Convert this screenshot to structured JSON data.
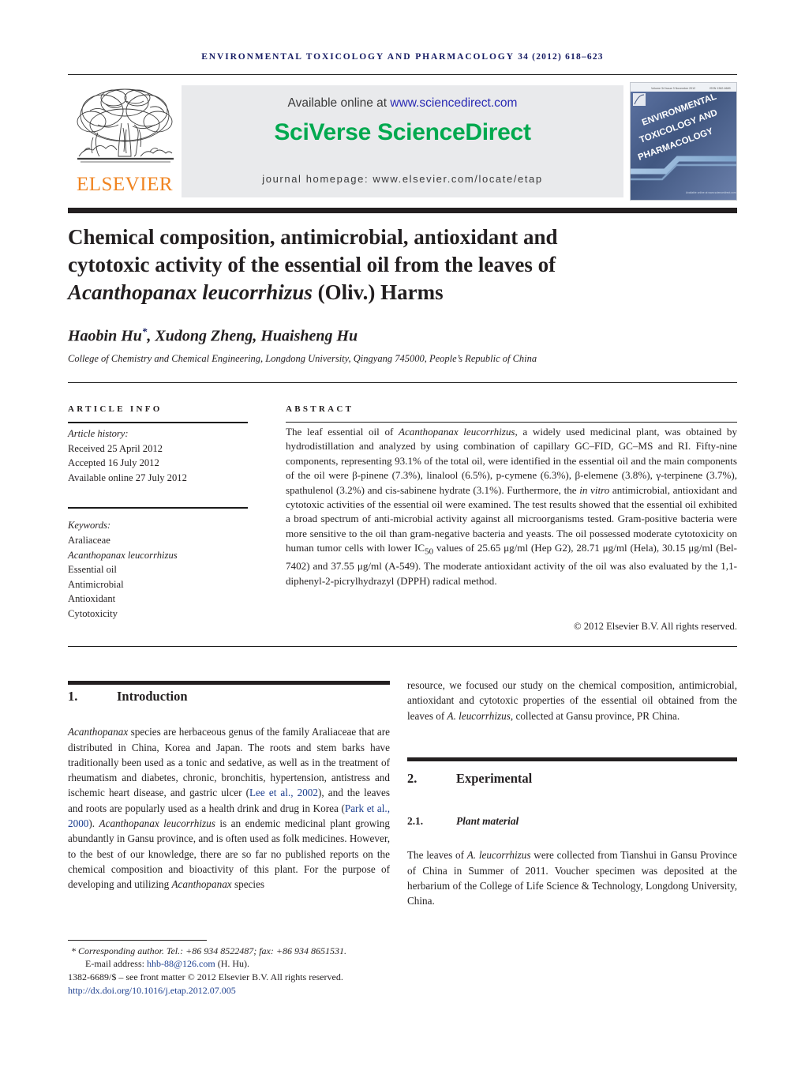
{
  "running_head": {
    "journal": "ENVIRONMENTAL TOXICOLOGY AND PHARMACOLOGY",
    "volume_issue": "34 (2012) 618–623"
  },
  "masthead": {
    "publisher_name": "ELSEVIER",
    "available_text": "Available online at ",
    "sciencedirect_url": "www.sciencedirect.com",
    "platform_logo": "SciVerse ScienceDirect",
    "journal_homepage": "journal homepage: www.elsevier.com/locate/etap",
    "cover_title_line1": "ENVIRONMENTAL",
    "cover_title_line2": "TOXICOLOGY AND",
    "cover_title_line3": "PHARMACOLOGY",
    "cover_top_meta": "Volume 34  Issue 3  November 2012",
    "cover_issn": "ISSN 1382-6689"
  },
  "article": {
    "title_line1": "Chemical composition, antimicrobial, antioxidant and",
    "title_line2": "cytotoxic activity of the essential oil from the leaves of",
    "title_species": "Acanthopanax leucorrhizus",
    "title_line3_tail": " (Oliv.) Harms",
    "authors": "Haobin Hu",
    "authors_marker": "*",
    "authors_rest": ", Xudong Zheng, Huaisheng Hu",
    "affiliation": "College of Chemistry and Chemical Engineering, Longdong University, Qingyang 745000, People’s Republic of China"
  },
  "article_info": {
    "heading": "ARTICLE INFO",
    "history_label": "Article history:",
    "received": "Received 25 April 2012",
    "accepted": "Accepted 16 July 2012",
    "available_online": "Available online 27 July 2012",
    "keywords_label": "Keywords:",
    "keywords": [
      "Araliaceae",
      "Acanthopanax leucorrhizus",
      "Essential oil",
      "Antimicrobial",
      "Antioxidant",
      "Cytotoxicity"
    ]
  },
  "abstract": {
    "heading": "ABSTRACT",
    "p1_a": "The leaf essential oil of ",
    "p1_species": "Acanthopanax leucorrhizus",
    "p1_b": ", a widely used medicinal plant, was obtained by hydrodistillation and analyzed by using combination of capillary GC–FID, GC–MS and RI. Fifty-nine components, representing 93.1% of the total oil, were identified in the essential oil and the main components of the oil were β-pinene (7.3%), linalool (6.5%), p-cymene (6.3%), β-elemene (3.8%), γ-terpinene (3.7%), spathulenol (3.2%) and cis-sabinene hydrate (3.1%). Furthermore, the ",
    "p1_invitro": "in vitro",
    "p1_c": " antimicrobial, antioxidant and cytotoxic activities of the essential oil were examined. The test results showed that the essential oil exhibited a broad spectrum of anti-microbial activity against all microorganisms tested. Gram-positive bacteria were more sensitive to the oil than gram-negative bacteria and yeasts. The oil possessed moderate cytotoxicity on human tumor cells with lower IC",
    "p1_sub": "50",
    "p1_d": " values of 25.65 μg/ml (Hep G2), 28.71 μg/ml (Hela), 30.15 μg/ml (Bel-7402) and 37.55 μg/ml (A-549). The moderate antioxidant activity of the oil was also evaluated by the 1,1-diphenyl-2-picrylhydrazyl (DPPH) radical method.",
    "copyright": "© 2012 Elsevier B.V. All rights reserved."
  },
  "body": {
    "section1_number": "1.",
    "section1_title": "Introduction",
    "intro_species": "Acanthopanax",
    "intro_a": " species are herbaceous genus of the family Araliaceae that are distributed in China, Korea and Japan. The roots and stem barks have traditionally been used as a tonic and sedative, as well as in the treatment of rheumatism and diabetes, chronic, bronchitis, hypertension, antistress and ischemic heart disease, and gastric ulcer (",
    "cite1": "Lee et al., 2002",
    "intro_b": "), and the leaves and roots are popularly used as a health drink and drug in Korea (",
    "cite2": "Park et al., 2000",
    "intro_c": "). ",
    "intro_species2": "Acanthopanax leucorrhizus",
    "intro_d": " is an endemic medicinal plant growing abundantly in Gansu province, and is often used as folk medicines. However, to the best of our knowledge, there are so far no published reports on the chemical composition and bioactivity of this plant. For the purpose of developing and utilizing ",
    "intro_species3": "Acanthopanax",
    "intro_e": " species",
    "right_cont_a": "resource, we focused our study on the chemical composition, antimicrobial, antioxidant and cytotoxic properties of the essential oil obtained from the leaves of ",
    "right_cont_species": "A. leucorrhizus",
    "right_cont_b": ", collected at Gansu province, PR China.",
    "section2_number": "2.",
    "section2_title": "Experimental",
    "subsection21_number": "2.1.",
    "subsection21_title": "Plant material",
    "plant_a": "The leaves of ",
    "plant_species": "A. leucorrhizus",
    "plant_b": " were collected from Tianshui in Gansu Province of China in Summer of 2011. Voucher specimen was deposited at the herbarium of the College of Life Science & Technology, Longdong University, China."
  },
  "footer": {
    "corresponding_marker": "*",
    "corresponding": " Corresponding author. Tel.: +86 934 8522487; fax: +86 934 8651531.",
    "email_label": "E-mail address: ",
    "email": "hhb-88@126.com",
    "email_owner": " (H. Hu).",
    "issn_line": "1382-6689/$ – see front matter © 2012 Elsevier B.V. All rights reserved.",
    "doi": "http://dx.doi.org/10.1016/j.etap.2012.07.005"
  },
  "colors": {
    "running_head": "#151b63",
    "elsevier_orange": "#f08421",
    "sciencedirect_green": "#00a94f",
    "link_blue": "#1d3f8f",
    "rule_black": "#231f20",
    "band_gray": "#e9eaec"
  }
}
